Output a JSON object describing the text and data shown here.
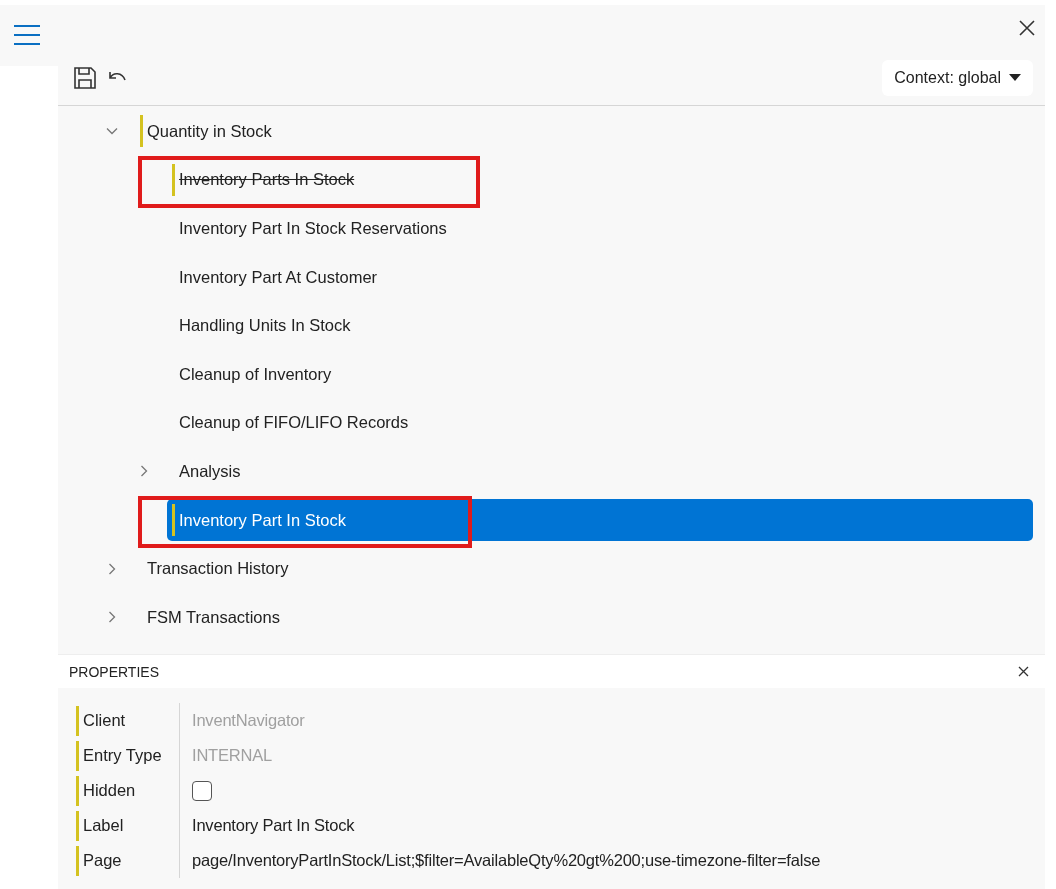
{
  "toolbar": {
    "context": "Context: global"
  },
  "tree": [
    {
      "label": "Quantity in Stock",
      "expanded": true,
      "modified": true,
      "deleted": false,
      "selected": false,
      "annotated": false,
      "children": [
        {
          "label": "Inventory Parts In Stock",
          "modified": true,
          "deleted": true,
          "selected": false,
          "annotated": true
        },
        {
          "label": "Inventory Part In Stock Reservations",
          "modified": false,
          "deleted": false,
          "selected": false,
          "annotated": false
        },
        {
          "label": "Inventory Part At Customer",
          "modified": false,
          "deleted": false,
          "selected": false,
          "annotated": false
        },
        {
          "label": "Handling Units In Stock",
          "modified": false,
          "deleted": false,
          "selected": false,
          "annotated": false
        },
        {
          "label": "Cleanup of Inventory",
          "modified": false,
          "deleted": false,
          "selected": false,
          "annotated": false
        },
        {
          "label": "Cleanup of FIFO/LIFO Records",
          "modified": false,
          "deleted": false,
          "selected": false,
          "annotated": false
        },
        {
          "label": "Analysis",
          "expanded": false,
          "modified": false,
          "deleted": false,
          "selected": false,
          "annotated": false
        },
        {
          "label": "Inventory Part In Stock",
          "modified": true,
          "deleted": false,
          "selected": true,
          "annotated": true
        }
      ]
    },
    {
      "label": "Transaction History",
      "expanded": false,
      "modified": false,
      "deleted": false,
      "selected": false,
      "annotated": false
    },
    {
      "label": "FSM Transactions",
      "expanded": false,
      "modified": false,
      "deleted": false,
      "selected": false,
      "annotated": false
    }
  ],
  "properties": {
    "title": "PROPERTIES",
    "rows": [
      {
        "kind": "text",
        "label": "Client",
        "value": "InventNavigator",
        "readonly": true,
        "modified": true
      },
      {
        "kind": "text",
        "label": "Entry Type",
        "value": "INTERNAL",
        "readonly": true,
        "modified": true
      },
      {
        "kind": "checkbox",
        "label": "Hidden",
        "checked": false,
        "modified": true
      },
      {
        "kind": "text",
        "label": "Label",
        "value": "Inventory Part In Stock",
        "readonly": false,
        "modified": true
      },
      {
        "kind": "text",
        "label": "Page",
        "value": "page/InventoryPartInStock/List;$filter=AvailableQty%20gt%200;use-timezone-filter=false",
        "readonly": false,
        "modified": true
      }
    ]
  }
}
